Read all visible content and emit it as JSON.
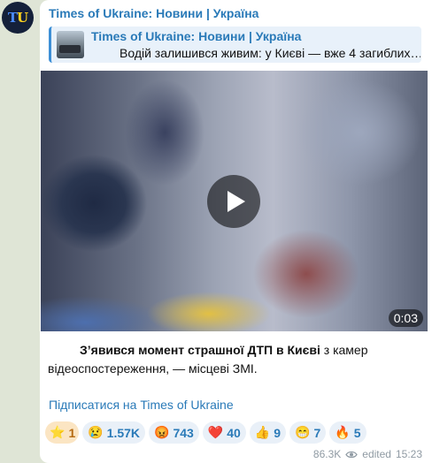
{
  "channel": {
    "avatar_letter_1": "T",
    "avatar_letter_2": "U",
    "name": "Times of Ukraine: Новини | Україна"
  },
  "reply": {
    "title": "Times of Ukraine: Новини | Україна",
    "text": "Водій залишився живим: у Києві — вже 4 загиблих…"
  },
  "video": {
    "duration": "0:03"
  },
  "caption": {
    "bold": "З’явився момент страшної ДТП в Києві",
    "rest": " з камер відеоспостереження, — місцеві ЗМІ."
  },
  "subscribe_link": "Підписатися на Times of Ukraine",
  "reactions": [
    {
      "emoji": "⭐",
      "count": "1"
    },
    {
      "emoji": "😢",
      "count": "1.57K"
    },
    {
      "emoji": "😡",
      "count": "743"
    },
    {
      "emoji": "❤️",
      "count": "40"
    },
    {
      "emoji": "👍",
      "count": "9"
    },
    {
      "emoji": "😁",
      "count": "7"
    },
    {
      "emoji": "🔥",
      "count": "5"
    }
  ],
  "footer": {
    "views": "86.3K",
    "edited": "edited",
    "time": "15:23"
  },
  "colors": {
    "accent": "#2a7ab8",
    "background": "#dfe5d6",
    "bubble": "#ffffff"
  }
}
